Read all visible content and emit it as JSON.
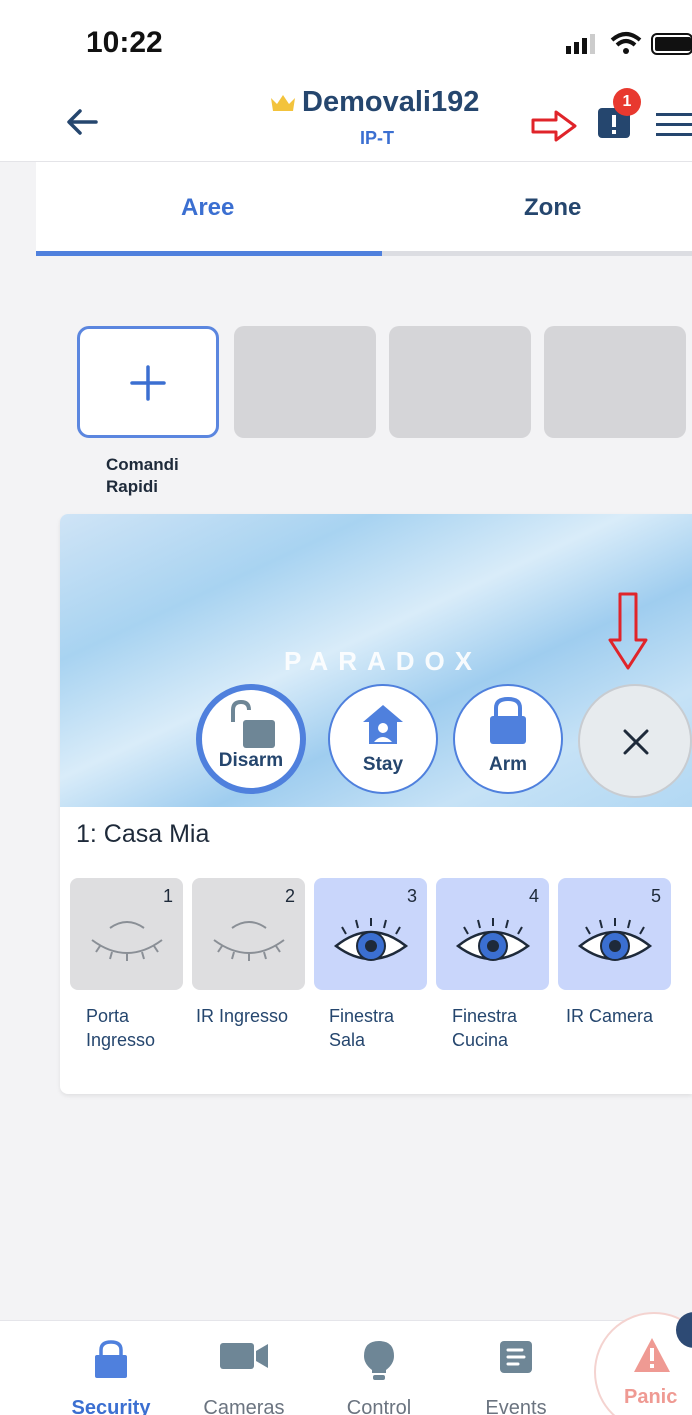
{
  "status": {
    "time": "10:22"
  },
  "header": {
    "title": "Demovali192",
    "subtitle": "IP-T",
    "alert_count": "1"
  },
  "tabs": [
    {
      "label": "Aree",
      "active": true
    },
    {
      "label": "Zone",
      "active": false
    }
  ],
  "quick_commands": {
    "label_line1": "Comandi",
    "label_line2": "Rapidi"
  },
  "area": {
    "brand": "PARADOX",
    "name": "1: Casa Mia",
    "arm_buttons": [
      {
        "label": "Disarm",
        "selected": true
      },
      {
        "label": "Stay",
        "selected": false
      },
      {
        "label": "Arm",
        "selected": false
      }
    ],
    "zones": [
      {
        "num": "1",
        "line1": "Porta",
        "line2": "Ingresso",
        "state": "closed-eye"
      },
      {
        "num": "2",
        "line1": "IR Ingresso",
        "line2": "",
        "state": "closed-eye"
      },
      {
        "num": "3",
        "line1": "Finestra",
        "line2": "Sala",
        "state": "open-eye"
      },
      {
        "num": "4",
        "line1": "Finestra",
        "line2": "Cucina",
        "state": "open-eye"
      },
      {
        "num": "5",
        "line1": "IR Camera",
        "line2": "",
        "state": "open-eye"
      }
    ]
  },
  "nav": [
    {
      "label": "Security",
      "active": true,
      "icon": "lock-icon"
    },
    {
      "label": "Cameras",
      "active": false,
      "icon": "camera-icon"
    },
    {
      "label": "Control",
      "active": false,
      "icon": "bulb-icon"
    },
    {
      "label": "Events",
      "active": false,
      "icon": "events-icon"
    }
  ],
  "panic": {
    "label": "Panic"
  },
  "colors": {
    "accent": "#4f80dd",
    "navy": "#25466e",
    "alert": "#e8392f",
    "zone_active": "#c9d6fb"
  }
}
